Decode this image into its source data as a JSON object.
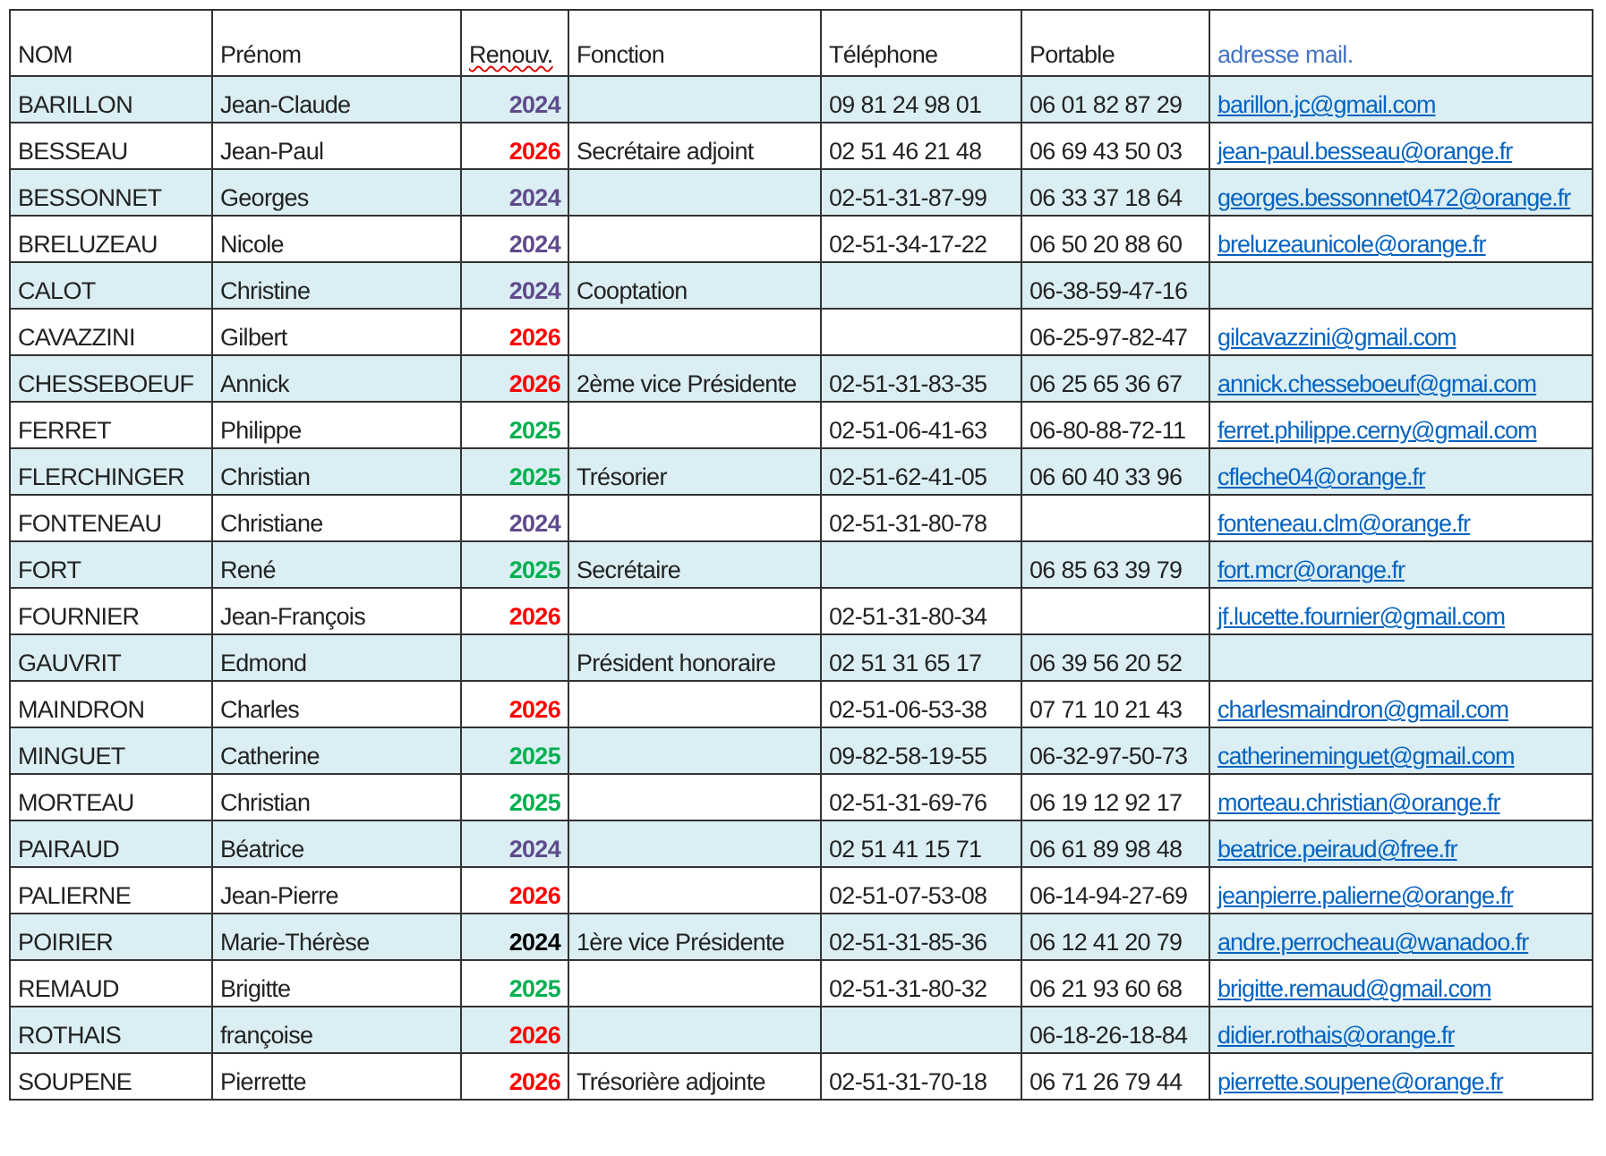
{
  "table": {
    "columns": [
      "NOM",
      "Prénom",
      "Renouv.",
      "Fonction",
      "Téléphone",
      "Portable",
      "adresse mail."
    ],
    "rows": [
      {
        "nom": "BARILLON",
        "prenom": "Jean-Claude",
        "renouv": {
          "text": "2024",
          "color": "#5f4b8b"
        },
        "telephone": "09 81 24 98 01",
        "portable": "06 01 82 87 29",
        "email": "barillon.jc@gmail.com"
      },
      {
        "nom": "BESSEAU",
        "prenom": "Jean-Paul",
        "renouv": {
          "text": "2026",
          "color": "#ff0000"
        },
        "fonction": "Secrétaire adjoint",
        "telephone": "02 51 46 21 48",
        "portable": "06 69 43 50 03",
        "email": "jean-paul.besseau@orange.fr"
      },
      {
        "nom": "BESSONNET",
        "prenom": "Georges",
        "renouv": {
          "text": "2024",
          "color": "#5f4b8b"
        },
        "telephone": "02-51-31-87-99",
        "portable": "06 33 37 18 64",
        "email": "georges.bessonnet0472@orange.fr"
      },
      {
        "nom": "BRELUZEAU",
        "prenom": "Nicole",
        "renouv": {
          "text": "2024",
          "color": "#5f4b8b"
        },
        "telephone": "02-51-34-17-22",
        "portable": "06 50 20 88 60",
        "email": "breluzeaunicole@orange.fr"
      },
      {
        "nom": "CALOT",
        "prenom": "Christine",
        "renouv": {
          "text": "2024",
          "color": "#5f4b8b"
        },
        "fonction": "Cooptation",
        "portable": "06-38-59-47-16"
      },
      {
        "nom": "CAVAZZINI",
        "prenom": "Gilbert",
        "renouv": {
          "text": "2026",
          "color": "#ff0000"
        },
        "portable": "06-25-97-82-47",
        "email": "gilcavazzini@gmail.com"
      },
      {
        "nom": "CHESSEBOEUF",
        "prenom": "Annick",
        "renouv": {
          "text": "2026",
          "color": "#ff0000"
        },
        "fonction": "2ème vice Présidente",
        "telephone": "02-51-31-83-35",
        "portable": "06 25 65 36 67",
        "email": "annick.chesseboeuf@gmai.com"
      },
      {
        "nom": "FERRET",
        "prenom": "Philippe",
        "renouv": {
          "text": "2025",
          "color": "#00b050"
        },
        "telephone": "02-51-06-41-63",
        "portable": "06-80-88-72-11",
        "email": "ferret.philippe.cerny@gmail.com"
      },
      {
        "nom": "FLERCHINGER",
        "prenom": "Christian",
        "renouv": {
          "text": "2025",
          "color": "#00b050"
        },
        "fonction": "Trésorier",
        "telephone": "02-51-62-41-05",
        "portable": "06 60 40 33 96",
        "email": "cfleche04@orange.fr"
      },
      {
        "nom": "FONTENEAU",
        "prenom": "Christiane",
        "renouv": {
          "text": "2024",
          "color": "#5f4b8b"
        },
        "telephone": "02-51-31-80-78",
        "email": "fonteneau.clm@orange.fr"
      },
      {
        "nom": "FORT",
        "prenom": "René",
        "renouv": {
          "text": "2025",
          "color": "#00b050"
        },
        "fonction": "Secrétaire",
        "portable": "06 85 63 39 79",
        "email": "fort.mcr@orange.fr"
      },
      {
        "nom": "FOURNIER",
        "prenom": "Jean-François",
        "renouv": {
          "text": "2026",
          "color": "#ff0000"
        },
        "telephone": "02-51-31-80-34",
        "email": "jf.lucette.fournier@gmail.com"
      },
      {
        "nom": "GAUVRIT",
        "prenom": "Edmond",
        "fonction": "Président honoraire",
        "telephone": "02 51 31 65 17",
        "portable": "06 39 56 20 52"
      },
      {
        "nom": "MAINDRON",
        "prenom": "Charles",
        "renouv": {
          "text": "2026",
          "color": "#ff0000"
        },
        "telephone": "02-51-06-53-38",
        "portable": "07 71 10 21 43",
        "email": "charlesmaindron@gmail.com"
      },
      {
        "nom": "MINGUET",
        "prenom": "Catherine",
        "renouv": {
          "text": "2025",
          "color": "#00b050"
        },
        "telephone": "09-82-58-19-55",
        "portable": "06-32-97-50-73",
        "email": "catherineminguet@gmail.com"
      },
      {
        "nom": "MORTEAU",
        "prenom": "Christian",
        "renouv": {
          "text": "2025",
          "color": "#00b050"
        },
        "telephone": "02-51-31-69-76",
        "portable": "06 19 12 92 17",
        "email": "morteau.christian@orange.fr"
      },
      {
        "nom": "PAIRAUD",
        "prenom": "Béatrice",
        "renouv": {
          "text": "2024",
          "color": "#5f4b8b"
        },
        "telephone": "02 51 41 15 71",
        "portable": "06 61 89 98 48",
        "email": "beatrice.peiraud@free.fr"
      },
      {
        "nom": "PALIERNE",
        "prenom": "Jean-Pierre",
        "renouv": {
          "text": "2026",
          "color": "#ff0000"
        },
        "telephone": "02-51-07-53-08",
        "portable": "06-14-94-27-69",
        "email": "jeanpierre.palierne@orange.fr"
      },
      {
        "nom": "POIRIER",
        "prenom": "Marie-Thérèse",
        "renouv": {
          "text": "2024",
          "color": "#000000"
        },
        "fonction": "1ère vice Présidente",
        "telephone": "02-51-31-85-36",
        "portable": "06 12 41 20 79",
        "email": "andre.perrocheau@wanadoo.fr"
      },
      {
        "nom": "REMAUD",
        "prenom": "Brigitte",
        "renouv": {
          "text": "2025",
          "color": "#00b050"
        },
        "telephone": "02-51-31-80-32",
        "portable": "06 21 93 60 68",
        "email": "brigitte.remaud@gmail.com"
      },
      {
        "nom": "ROTHAIS",
        "prenom": "françoise",
        "renouv": {
          "text": "2026",
          "color": "#ff0000"
        },
        "portable": "06-18-26-18-84",
        "email": "didier.rothais@orange.fr"
      },
      {
        "nom": "SOUPENE",
        "prenom": "Pierrette",
        "renouv": {
          "text": "2026",
          "color": "#ff0000"
        },
        "fonction": "Trésorière adjointe",
        "telephone": "02-51-31-70-18",
        "portable": "06 71 26 79 44",
        "email": "pierrette.soupene@orange.fr"
      }
    ]
  }
}
